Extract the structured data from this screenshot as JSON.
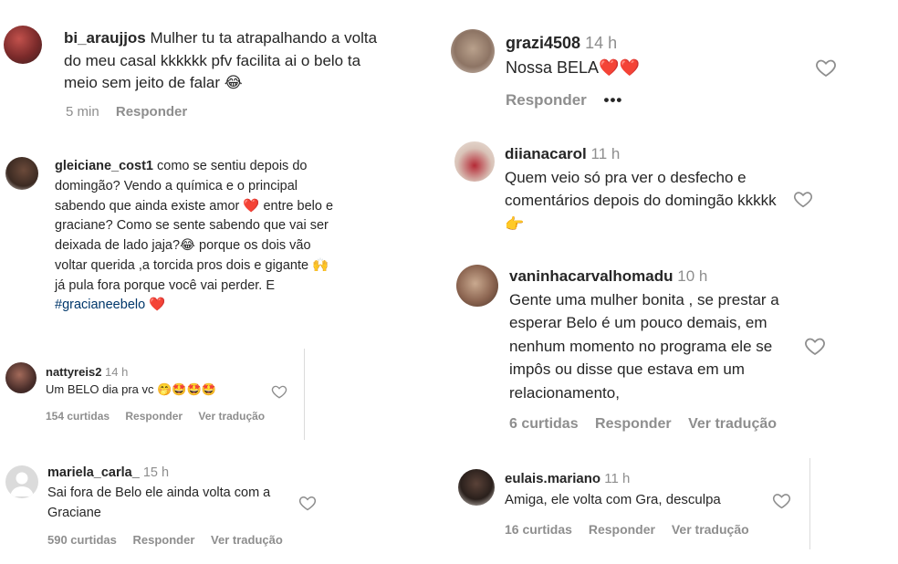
{
  "comments": [
    {
      "user": "bi_araujjos",
      "text": "Mulher tu ta atrapalhando a volta do meu casal kkkkkk pfv facilita ai o belo ta meio sem jeito de falar 😂",
      "time": "5 min",
      "reply": "Responder"
    },
    {
      "user": "gleiciane_cost1",
      "text": "como se sentiu depois do domingão? Vendo a química e o principal sabendo que ainda existe amor ❤️ entre belo e graciane? Como se sente sabendo que vai ser deixada de lado jaja?😂 porque os dois vão voltar querida ,a torcida pros dois e gigante 🙌 já pula fora porque você vai perder. E",
      "hashtag": "#gracianeebelo",
      "hashtag_emoji": "❤️"
    },
    {
      "user": "nattyreis2",
      "time": "14 h",
      "text": "Um BELO dia pra vc 🤭🤩🤩🤩",
      "likes": "154 curtidas",
      "reply": "Responder",
      "translate": "Ver tradução"
    },
    {
      "user": "mariela_carla_",
      "time": "15 h",
      "text": "Sai fora de Belo ele ainda volta com a Graciane",
      "likes": "590 curtidas",
      "reply": "Responder",
      "translate": "Ver tradução"
    },
    {
      "user": "grazi4508",
      "time": "14 h",
      "text": "Nossa BELA❤️❤️",
      "reply": "Responder",
      "more": "•••"
    },
    {
      "user": "diianacarol",
      "time": "11 h",
      "text": "Quem veio só pra ver o desfecho e comentários depois do domingão kkkkk 👉"
    },
    {
      "user": "vaninhacarvalhomadu",
      "time": "10 h",
      "text": "Gente uma mulher bonita , se prestar a esperar Belo é um pouco demais, em nenhum momento no programa ele se impôs ou disse que estava em um relacionamento,",
      "likes": "6 curtidas",
      "reply": "Responder",
      "translate": "Ver tradução"
    },
    {
      "user": "eulais.mariano",
      "time": "11 h",
      "text": "Amiga, ele volta com Gra, desculpa",
      "likes": "16 curtidas",
      "reply": "Responder",
      "translate": "Ver tradução"
    }
  ],
  "colors": {
    "text": "#262626",
    "muted": "#8e8e8e",
    "heart_red": "#e0202f",
    "link": "#00376b"
  },
  "icons": {
    "like": "heart-outline-icon",
    "avatar_default": "default-avatar-icon"
  }
}
